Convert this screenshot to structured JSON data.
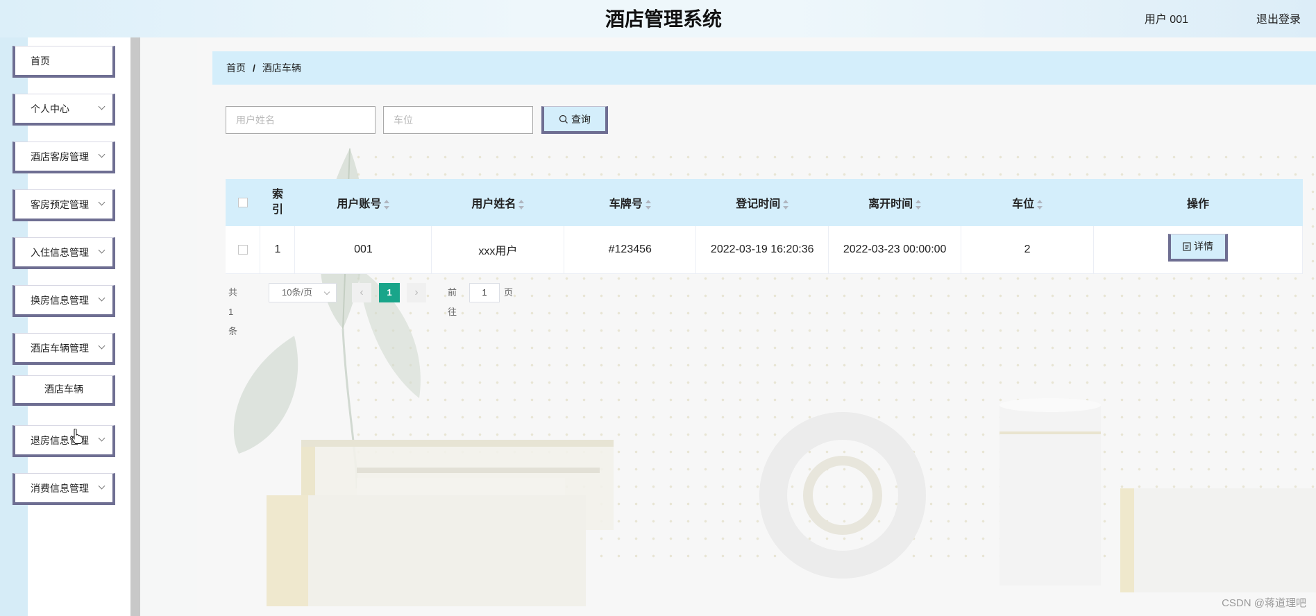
{
  "header": {
    "title": "酒店管理系统",
    "user": "用户 001",
    "logout": "退出登录"
  },
  "sidebar": {
    "items": [
      {
        "label": "首页",
        "has_children": false
      },
      {
        "label": "个人中心",
        "has_children": true
      },
      {
        "label": "酒店客房管理",
        "has_children": true
      },
      {
        "label": "客房预定管理",
        "has_children": true
      },
      {
        "label": "入住信息管理",
        "has_children": true
      },
      {
        "label": "换房信息管理",
        "has_children": true
      },
      {
        "label": "酒店车辆管理",
        "has_children": true
      },
      {
        "label": "退房信息管理",
        "has_children": true
      },
      {
        "label": "消费信息管理",
        "has_children": true
      }
    ],
    "submenu": {
      "label": "酒店车辆"
    }
  },
  "breadcrumb": {
    "home": "首页",
    "separator": "/",
    "current": "酒店车辆"
  },
  "search": {
    "name_placeholder": "用户姓名",
    "spot_placeholder": "车位",
    "button_label": "查询"
  },
  "table": {
    "columns": [
      "索引",
      "用户账号",
      "用户姓名",
      "车牌号",
      "登记时间",
      "离开时间",
      "车位",
      "操作"
    ],
    "index_header_lines": [
      "索",
      "引"
    ],
    "rows": [
      {
        "index": "1",
        "account": "001",
        "name": "xxx用户",
        "plate": "#123456",
        "checkin": "2022-03-19 16:20:36",
        "leave": "2022-03-23 00:00:00",
        "spot": "2",
        "action": "详情"
      }
    ]
  },
  "pagination": {
    "total": "共 1 条",
    "page_size": "10条/页",
    "current_page": "1",
    "goto_prefix": "前往",
    "goto_value": "1",
    "goto_suffix": "页"
  },
  "watermark": "CSDN @蒋道理吧",
  "colors": {
    "accent_blue": "#d4eefb",
    "border_purple": "#6e6e92",
    "page_active": "#19a58a"
  }
}
